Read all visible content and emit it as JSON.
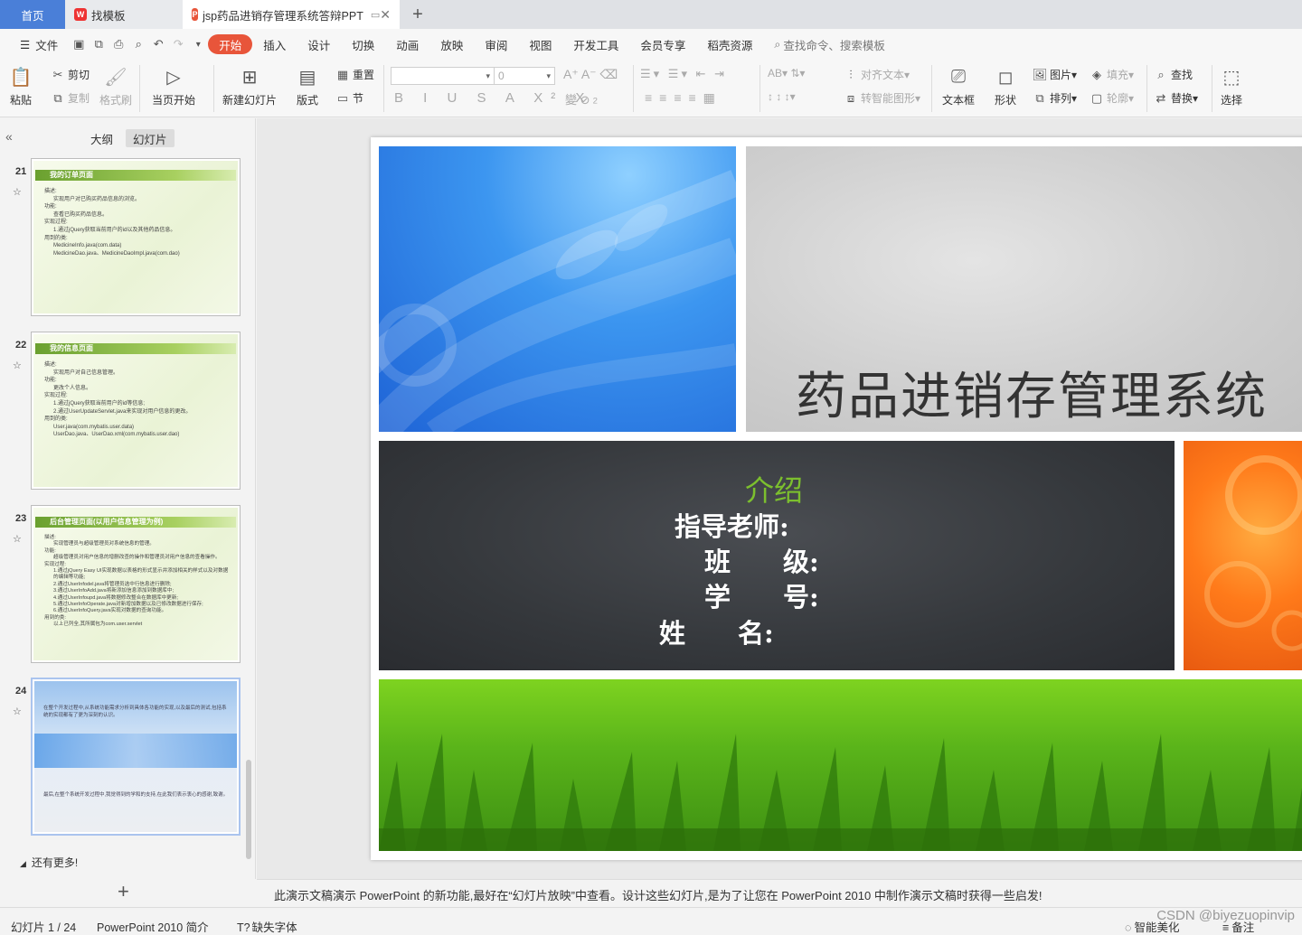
{
  "tabs": {
    "home": "首页",
    "templates": "找模板",
    "document": "jsp药品进销存管理系统答辩PPT"
  },
  "menu": {
    "file": "文件",
    "items": [
      "开始",
      "插入",
      "设计",
      "切换",
      "动画",
      "放映",
      "审阅",
      "视图",
      "开发工具",
      "会员专享",
      "稻壳资源"
    ],
    "search": "查找命令、搜索模板"
  },
  "ribbon": {
    "paste": "粘贴",
    "cut": "剪切",
    "copy": "复制",
    "format_painter": "格式刷",
    "from_start": "当页开始",
    "new_slide": "新建幻灯片",
    "layout": "版式",
    "reset": "重置",
    "section": "节",
    "font_size": "0",
    "align_text": "对齐文本",
    "smart_art": "转智能图形",
    "textbox": "文本框",
    "shape": "形状",
    "picture": "图片",
    "arrange": "排列",
    "fill": "填充",
    "outline": "轮廓",
    "find": "查找",
    "replace": "替换",
    "select": "选择"
  },
  "left_panel": {
    "tab_outline": "大纲",
    "tab_slides": "幻灯片",
    "more": "还有更多!",
    "thumbnails": [
      {
        "num": "21",
        "title": "我的订单页面",
        "lines": [
          "描述:",
          "实现用户对已购买药品信息的浏览。",
          "功能:",
          "查看已购买药品信息。",
          "实现过程:",
          "1.通过jQuery获取当前用户的id以及其他药品信息。",
          "用到的类:",
          "MedicineInfo.java(com.data)",
          "MedicineDao.java、MedicineDaoImpl.java(com.dao)"
        ]
      },
      {
        "num": "22",
        "title": "我的信息页面",
        "lines": [
          "描述:",
          "实现用户对自己信息管理。",
          "功能:",
          "更改个人信息。",
          "实现过程:",
          "1.通过jQuery获取当前用户的id等信息;",
          "2.通过UserUpdateServlet.java来实现对用户信息的更改。",
          "用到的类:",
          "User.java(com.mybatis.user.data)",
          "UserDao.java、UserDao.xml(com.mybatis.user.dao)"
        ]
      },
      {
        "num": "23",
        "title": "后台管理页面(以用户信息管理为例)",
        "lines": [
          "描述:",
          "实现管理员与超级管理员对系统信息的管理。",
          "功能:",
          "超级管理员对用户信息的增删改查的操作和管理员对用户信息的查看操作。",
          "实现过程:",
          "1.通过jQuery Easy UI实现数据以表格的形式显示并添加相关的样式以及对数据的编辑等功能;",
          "2.通过UserInfodel.java将管理员选中行信息进行删除;",
          "3.通过UserInfoAdd.java将新添加信息添加到数据库中;",
          "4.通过UserInfoupd.java将数据修改整合在数据库中更新;",
          "5.通过UserInfoOperate.java对新增加数据以及已修改数据进行保存;",
          "6.通过UserInfoQuery.java实现对数据的查询功能。",
          "用到的类:",
          "以上已列全,其所属包为com.user.servlet"
        ]
      },
      {
        "num": "24",
        "title": "",
        "lines": [
          "在整个开发过程中,从系统功能需求分析到具体各功能的实现,以及最后的测试,包括系统的实现都有了更为深刻的认识。",
          "最后,在整个系统开发过程中,我觉得到的学和的支持,在此我们表示衷心的感谢,致谢。"
        ]
      }
    ]
  },
  "slide": {
    "title": "药品进销存管理系统",
    "intro": "介绍",
    "advisor": "指导老师:",
    "class": "班　　级:",
    "student_id": "学　　号:",
    "name": "姓　　名:"
  },
  "notes": "此演示文稿演示 PowerPoint 的新功能,最好在“幻灯片放映”中查看。设计这些幻灯片,是为了让您在 PowerPoint 2010 中制作演示文稿时获得一些启发!",
  "status": {
    "slide_count": "幻灯片 1 / 24",
    "template_name": "PowerPoint 2010 简介",
    "missing_font": "缺失字体",
    "beautify": "智能美化",
    "notes": "备注",
    "watermark": "CSDN @biyezuopinvip"
  },
  "colors": {
    "accent_tab": "#4a7fd8",
    "start_menu": "#e8553a",
    "intro_green": "#7cbf2e"
  }
}
